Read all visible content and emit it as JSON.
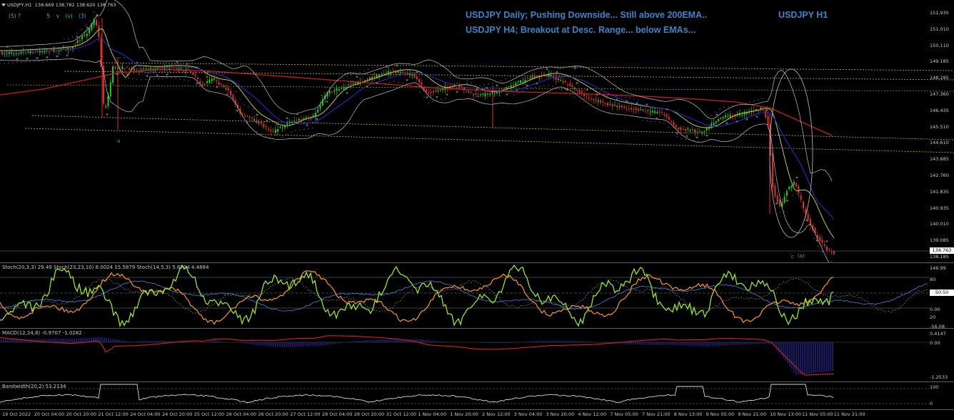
{
  "header": {
    "symbol_label": "USDJPY,H1",
    "ohlc": "138.669 138.782 138.620 138.763"
  },
  "wave_toolbar": [
    "(5) ?",
    "5",
    "v",
    "(v)",
    "(3)"
  ],
  "annotations": {
    "line1": "USDJPY Daily; Pushing Downside... Still above 200EMA..",
    "line2": "USDJPY H4; Breakout at Desc. Range... below EMAs...",
    "tag": "USDJPY H1"
  },
  "wave_labels": {
    "a": "a",
    "b": "b",
    "c": "c",
    "paren_a": "(a)"
  },
  "price_axis": {
    "ticks": [
      "151.935",
      "151.010",
      "150.110",
      "149.185",
      "148.285",
      "147.360",
      "146.435",
      "145.510",
      "144.610",
      "143.685",
      "142.760",
      "141.835",
      "140.935",
      "140.010",
      "139.085",
      "138.185"
    ],
    "current_price": "138.763"
  },
  "stoch_pane": {
    "label": "Stoch(20,3,3) 29.49  Stoch(23,23,10) 8.0024 15.5879  Stoch(14,5,3) 5.6704 4.4884",
    "ticks": [
      "146.99",
      "80",
      "50.50",
      "0.00",
      "20",
      "-56.08"
    ]
  },
  "macd_pane": {
    "label": "MACD(12,24,8) -0.9707 -1.0282",
    "ticks": [
      "0.4147",
      "0.00",
      "-1.2533"
    ]
  },
  "bw_pane": {
    "label": "Bandwidth(20,2) 53.2134",
    "ticks": [
      "100",
      "0"
    ]
  },
  "time_axis": [
    "19 Oct 2022",
    "20 Oct 04:00",
    "20 Oct 20:00",
    "21 Oct 12:00",
    "24 Oct 04:00",
    "24 Oct 20:00",
    "25 Oct 12:00",
    "26 Oct 04:00",
    "26 Oct 20:00",
    "27 Oct 12:00",
    "28 Oct 04:00",
    "28 Oct 20:00",
    "31 Oct 12:00",
    "1 Nov 04:00",
    "1 Nov 20:00",
    "2 Nov 12:00",
    "3 Nov 04:00",
    "3 Nov 20:00",
    "4 Nov 12:00",
    "7 Nov 05:00",
    "7 Nov 21:00",
    "8 Nov 13:00",
    "9 Nov 05:00",
    "9 Nov 21:00",
    "10 Nov 13:00",
    "11 Nov 05:00",
    "11 Nov 21:00"
  ],
  "colors": {
    "bull": "#28c828",
    "bear": "#e03030",
    "ema_red": "#c81e1e",
    "ema_blue": "#2828c8",
    "ema_yellow": "#c8c832",
    "bands": "#c0c0c0",
    "channel": "#d2b41e",
    "stoch_green": "#96e628",
    "stoch_orange": "#ff9620",
    "stoch_blue": "#3c78c8",
    "macd_hist": "#3232c8",
    "macd_signal": "#e01e1e",
    "annotation": "#3c84c8"
  }
}
